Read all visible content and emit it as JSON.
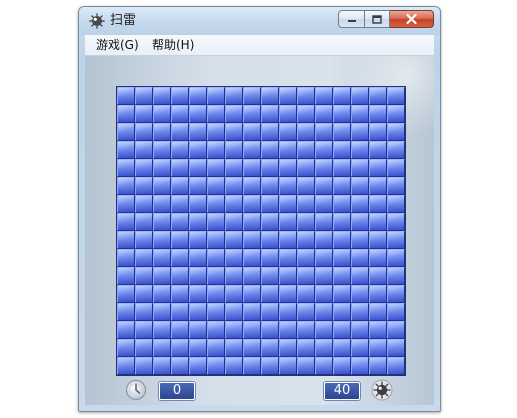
{
  "window": {
    "title": "扫雷",
    "app_icon": "mine-icon"
  },
  "caption_buttons": {
    "minimize_icon": "minimize-icon",
    "maximize_icon": "maximize-icon",
    "close_icon": "close-icon"
  },
  "menubar": {
    "items": [
      {
        "label": "游戏(G)"
      },
      {
        "label": "帮助(H)"
      }
    ]
  },
  "board": {
    "rows": 16,
    "cols": 16,
    "state": "unrevealed"
  },
  "status": {
    "timer_icon": "clock-icon",
    "timer_value": "0",
    "mine_counter_value": "40",
    "mine_counter_icon": "mine-icon"
  },
  "colors": {
    "tile_top": "#8fb0ff",
    "tile_bottom": "#3c53d6",
    "close_button": "#c94a33",
    "counter_bg": "#2f4b9a"
  }
}
